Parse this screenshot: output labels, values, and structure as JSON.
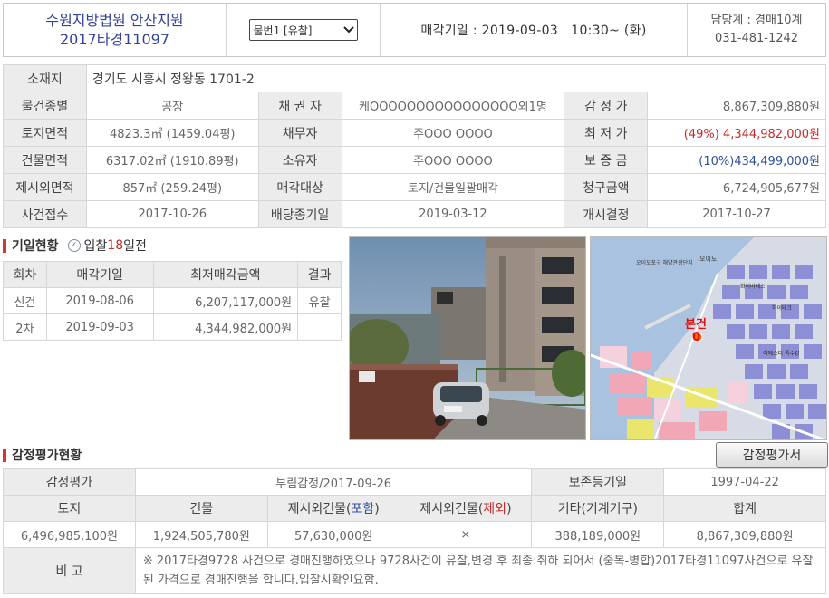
{
  "header": {
    "court": "수원지방법원 안산지원",
    "case_no": "2017타경11097",
    "item_select": "물번1 [유찰]",
    "sale_date_label": "매각기일 : ",
    "sale_date": "2019-09-03   10:30~ (화)",
    "dept": "담당계 : 경매10계",
    "phone": "031-481-1242"
  },
  "info": {
    "address_label": "소재지",
    "address": "경기도 시흥시 정왕동 1701-2",
    "rows": [
      [
        "물건종별",
        "공장",
        "채 권 자",
        "케OOOOOOOOOOOOOOOO외1명",
        "감 정 가",
        "8,867,309,880원"
      ],
      [
        "토지면적",
        "4823.3㎡ (1459.04평)",
        "채무자",
        "주OOO OOOO",
        "최 저 가",
        "(49%) 4,344,982,000원"
      ],
      [
        "건물면적",
        "6317.02㎡ (1910.89평)",
        "소유자",
        "주OOO OOOO",
        "보 증 금",
        "(10%)434,499,000원"
      ],
      [
        "제시외면적",
        "857㎡ (259.24평)",
        "매각대상",
        "토지/건물일괄매각",
        "청구금액",
        "6,724,905,677원"
      ],
      [
        "사건접수",
        "2017-10-26",
        "배당종기일",
        "2019-03-12",
        "개시결정",
        "2017-10-27"
      ]
    ]
  },
  "bid_section": {
    "title": "기일현황",
    "sub_prefix": "입찰",
    "sub_days": "18",
    "sub_suffix": "일전",
    "headers": [
      "회차",
      "매각기일",
      "최저매각금액",
      "결과"
    ],
    "rows": [
      [
        "신건",
        "2019-08-06",
        "6,207,117,000원",
        "유찰"
      ],
      [
        "2차",
        "2019-09-03",
        "4,344,982,000원",
        ""
      ]
    ]
  },
  "map": {
    "marker_label": "본건",
    "marker_num": "0",
    "place_1": "오이도",
    "place_2": "오이도포구\n해양관광단지",
    "place_3": "화이바쎄스",
    "place_4": "하이테크",
    "place_5": "이에스티\n특수강"
  },
  "appraisal_section": {
    "title": "감정평가현황",
    "button": "감정평가서",
    "row1": [
      "감정평가",
      "부림감정/2017-09-26",
      "보존등기일",
      "1997-04-22"
    ],
    "headers": [
      "토지",
      "건물",
      "제시외건물(",
      "포함",
      ")",
      "제시외건물(",
      "제외",
      ")",
      "기타(기계기구)",
      "합계"
    ],
    "values": [
      "6,496,985,100원",
      "1,924,505,780원",
      "57,630,000원",
      "×",
      "388,189,000원",
      "8,867,309,880원"
    ],
    "memo_label": "비 고",
    "memo": "※ 2017타경9728 사건으로 경매진행하였으나 9728사건이 유찰,변경 후 최종:취하 되어서 (중복-병합)2017타경11097사건으로 유찰된 가격으로 경매진행을 합니다.입찰시확인요함."
  },
  "colors": {
    "court_blue": "#33429a",
    "price_red": "#c72a2a",
    "deposit_blue": "#2e4fa2",
    "label_bg": "#ececec",
    "section_bar": "#d03a2a"
  }
}
